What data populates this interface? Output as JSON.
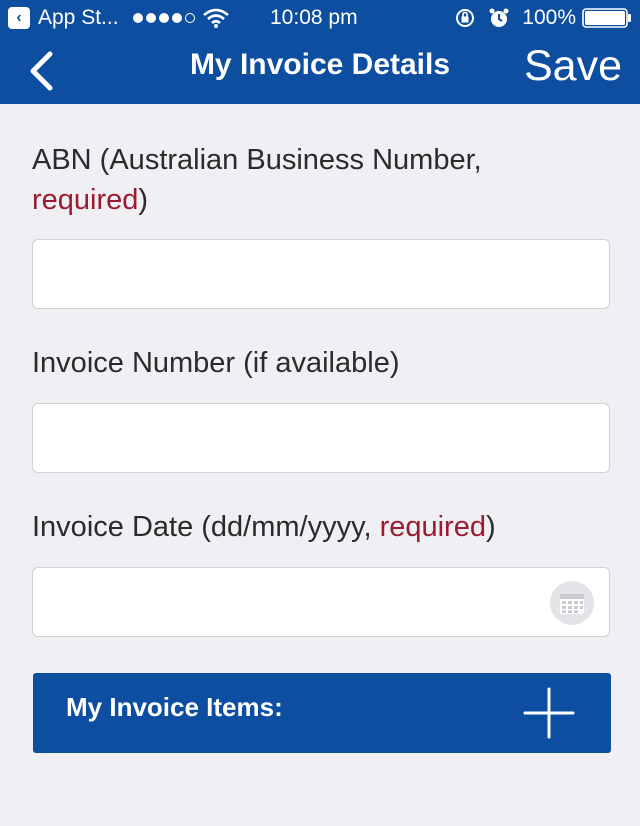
{
  "status_bar": {
    "back_app": "App St...",
    "time": "10:08 pm",
    "battery": "100%"
  },
  "nav": {
    "title": "My Invoice Details",
    "save_label": "Save"
  },
  "form": {
    "abn": {
      "label_line1": "ABN (Australian Business Number,",
      "label_required": "required",
      "label_close": ")",
      "value": ""
    },
    "invoice_number": {
      "label": "Invoice Number (if available)",
      "value": ""
    },
    "invoice_date": {
      "label_prefix": "Invoice Date (dd/mm/yyyy, ",
      "label_required": "required",
      "label_close": ")",
      "value": ""
    }
  },
  "items": {
    "label": "My Invoice Items:"
  },
  "colors": {
    "brand_blue": "#0d4ea1",
    "required_red": "#9b1b30",
    "background": "#efeff4"
  }
}
